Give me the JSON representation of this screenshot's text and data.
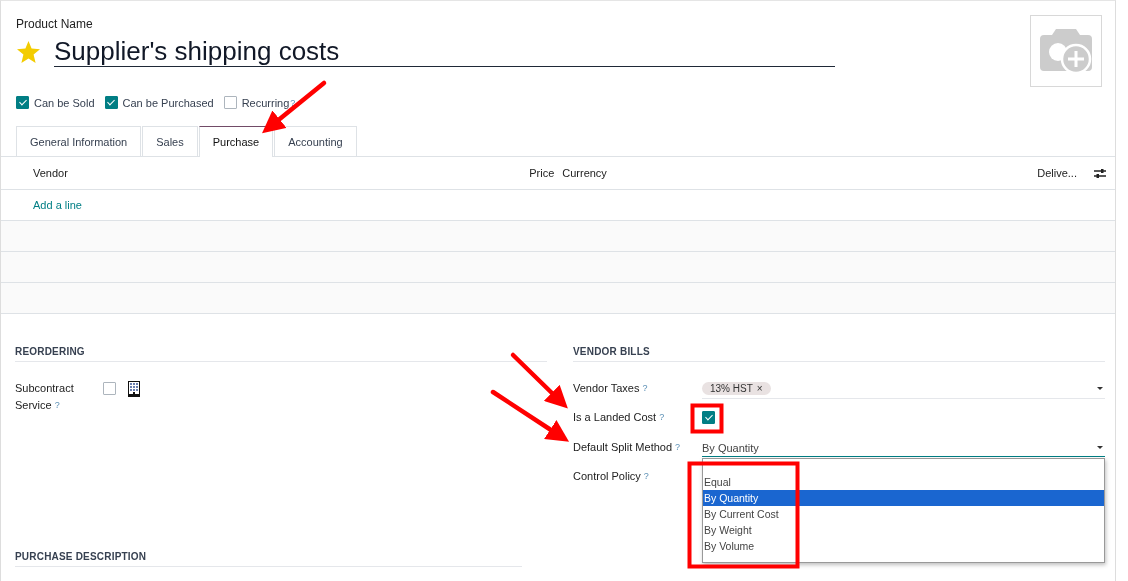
{
  "product_name_label": "Product Name",
  "favorite": true,
  "product_name": "Supplier's shipping costs",
  "options": [
    {
      "label": "Can be Sold",
      "checked": true
    },
    {
      "label": "Can be Purchased",
      "checked": true
    },
    {
      "label": "Recurring",
      "checked": false,
      "help": "?"
    }
  ],
  "tabs": [
    {
      "label": "General Information",
      "selected": false
    },
    {
      "label": "Sales",
      "selected": false
    },
    {
      "label": "Purchase",
      "selected": true
    },
    {
      "label": "Accounting",
      "selected": false
    }
  ],
  "vendor_table": {
    "columns": [
      "Vendor",
      "Price",
      "Currency",
      "Delive..."
    ],
    "add_line": "Add a line"
  },
  "reordering": {
    "title": "REORDERING",
    "fields": [
      {
        "kind": "checkbox",
        "label": "Subcontract Service",
        "help": "?",
        "checked": false
      }
    ]
  },
  "vendor_bills": {
    "title": "VENDOR BILLS",
    "fields": [
      {
        "kind": "tags",
        "label": "Vendor Taxes",
        "help": "?",
        "tags": [
          {
            "label": "13% HST",
            "remove": "×"
          }
        ]
      },
      {
        "kind": "checkbox",
        "label": "Is a Landed Cost",
        "help": "?",
        "checked": true
      },
      {
        "kind": "select",
        "label": "Default Split Method",
        "help": "?",
        "value": "By Quantity",
        "expanded": true,
        "options": [
          {
            "label": "Equal",
            "selected": false
          },
          {
            "label": "By Quantity",
            "selected": true
          },
          {
            "label": "By Current Cost",
            "selected": false
          },
          {
            "label": "By Weight",
            "selected": false
          },
          {
            "label": "By Volume",
            "selected": false
          }
        ]
      },
      {
        "kind": "empty",
        "label": "Control Policy",
        "help": "?"
      }
    ]
  },
  "purchase_description": {
    "title": "PURCHASE DESCRIPTION"
  }
}
